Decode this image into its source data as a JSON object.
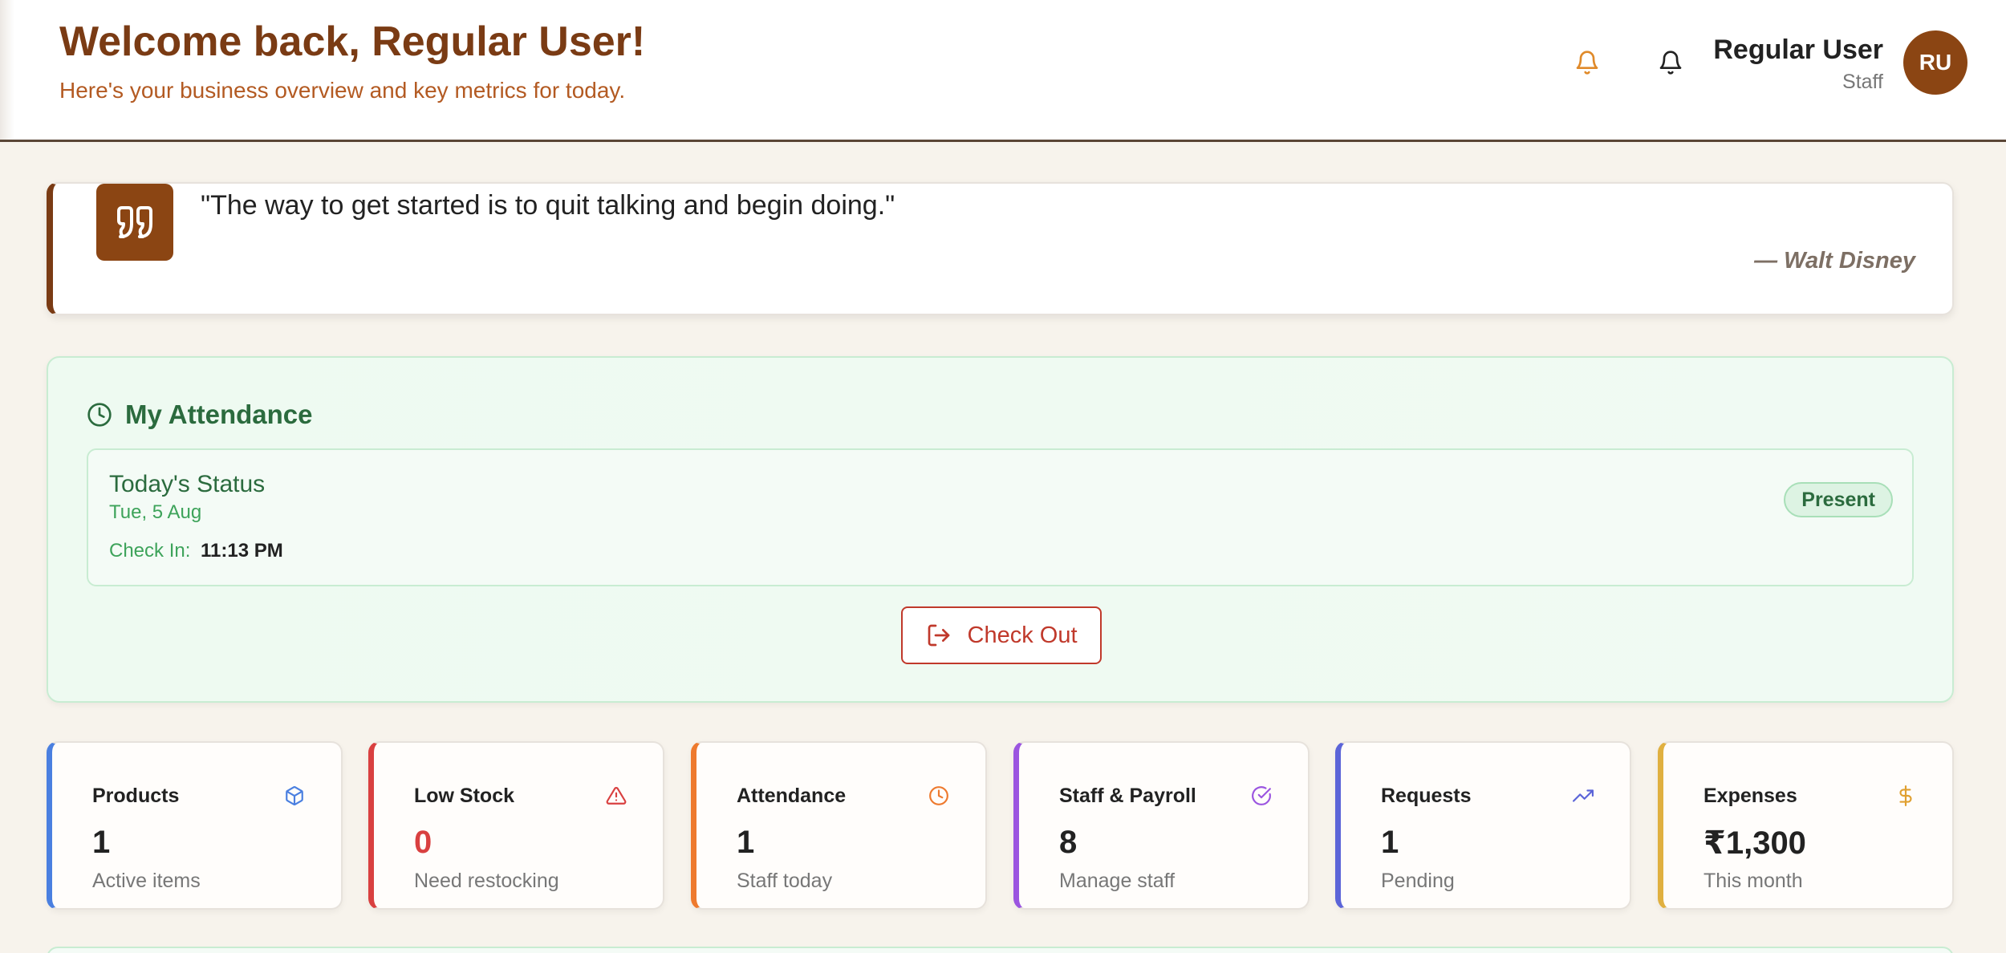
{
  "header": {
    "title": "Welcome back, Regular User!",
    "subtitle": "Here's your business overview and key metrics for today.",
    "user": {
      "name": "Regular User",
      "role": "Staff",
      "initials": "RU"
    }
  },
  "quote": {
    "text": "\"The way to get started is to quit talking and begin doing.\"",
    "author": "— Walt Disney"
  },
  "attendance": {
    "title": "My Attendance",
    "status_label": "Today's Status",
    "date": "Tue, 5 Aug",
    "checkin_label": "Check In:",
    "checkin_time": "11:13 PM",
    "badge": "Present",
    "checkout_label": "Check Out"
  },
  "stats": [
    {
      "title": "Products",
      "value": "1",
      "sub": "Active items",
      "color": "#4a7fe0",
      "icon": "box-icon"
    },
    {
      "title": "Low Stock",
      "value": "0",
      "sub": "Need restocking",
      "color": "#d94040",
      "icon": "warning-icon"
    },
    {
      "title": "Attendance",
      "value": "1",
      "sub": "Staff today",
      "color": "#ee7a2e",
      "icon": "clock-icon"
    },
    {
      "title": "Staff & Payroll",
      "value": "8",
      "sub": "Manage staff",
      "color": "#9b55e0",
      "icon": "check-circle-icon"
    },
    {
      "title": "Requests",
      "value": "1",
      "sub": "Pending",
      "color": "#5b64d8",
      "icon": "trending-up-icon"
    },
    {
      "title": "Expenses",
      "value": "₹1,300",
      "sub": "This month",
      "color": "#e0b040",
      "icon": "dollar-icon"
    }
  ]
}
